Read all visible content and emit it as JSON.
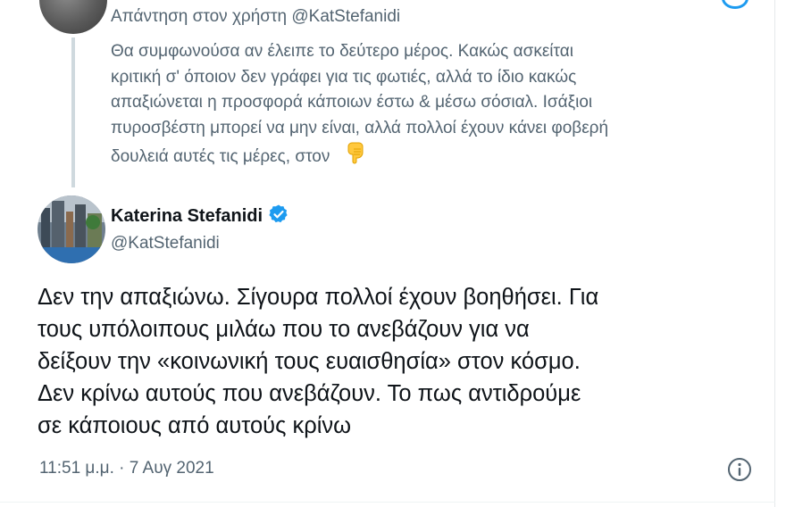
{
  "previous_tweet": {
    "reply_to": "Απάντηση στον χρήστη @KatStefanidi",
    "lines": [
      "Θα συμφωνούσα αν έλειπε το δεύτερο μέρος. Κακώς ασκείται",
      "κριτική σ' όποιον δεν γράφει για τις φωτιές, αλλά το ίδιο κακώς",
      "απαξιώνεται η προσφορά κάποιων έστω & μέσω σόσιαλ. Ισάξιοι",
      "πυροσβέστη μπορεί να μην είναι, αλλά πολλοί έχουν κάνει φοβερή",
      "δουλειά αυτές τις μέρες, στον"
    ],
    "emoji": "backhand-index-pointing-down"
  },
  "tweet": {
    "author_name": "Katerina Stefanidi",
    "author_handle": "@KatStefanidi",
    "verified": true,
    "lines": [
      "Δεν την απαξιώνω. Σίγουρα πολλοί έχουν βοηθήσει. Για",
      "τους υπόλοιπους μιλάω που το ανεβάζουν για να",
      "δείξουν την «κοινωνική τους ευαισθησία» στον κόσμο.",
      "Δεν κρίνω αυτούς που ανεβάζουν. Το πως αντιδρούμε",
      "σε κάποιους από αυτούς κρίνω"
    ],
    "timestamp": "11:51 μ.μ. · 7 Αυγ 2021"
  },
  "colors": {
    "accent": "#1d9bf0",
    "text_primary": "#0f1419",
    "text_secondary": "#536471",
    "thread_line": "#cfd9de"
  }
}
